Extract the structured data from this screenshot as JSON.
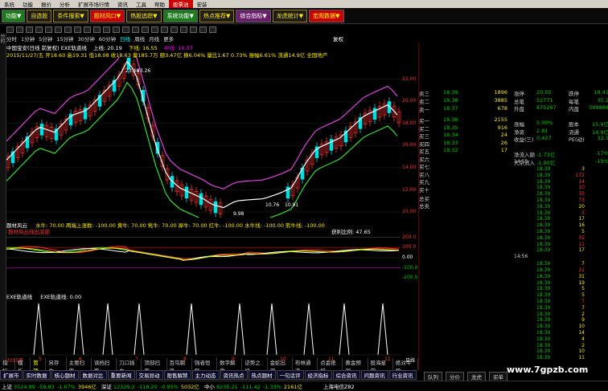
{
  "menu": [
    "系统",
    "功能",
    "报价",
    "分析",
    "扩展市场行情",
    "资讯",
    "工具",
    "帮助",
    "股票池",
    "安装"
  ],
  "menu_hot_index": 8,
  "toolbar_buttons": [
    {
      "label": "功能▼",
      "style": "green"
    },
    {
      "label": "自选股",
      "style": "yellow"
    },
    {
      "label": "条件搜索▼",
      "style": "yellow"
    },
    {
      "label": "题材风口▼",
      "style": "red"
    },
    {
      "label": "热股追踪▼",
      "style": "yellow"
    },
    {
      "label": "系统功能▼",
      "style": "green"
    },
    {
      "label": "热点推荐▼",
      "style": "yellow"
    },
    {
      "label": "综合指标▼",
      "style": "purple"
    },
    {
      "label": "龙虎统计▼",
      "style": "yellow"
    },
    {
      "label": "宏观数据▼",
      "style": "red"
    }
  ],
  "period_tabs": [
    "分时",
    "1分钟",
    "5分钟",
    "15分钟",
    "30分钟",
    "60分钟",
    "日线",
    "周线",
    "月线",
    "更多"
  ],
  "period_selected": 6,
  "side_labels": [
    "分时",
    "技术分析",
    "基本资料"
  ],
  "top_right_label": "复权",
  "main_title_line": "中国宝安(日线 前复权) EXE轨道线",
  "main_title_vals": {
    "up": "上线: 20.19",
    "down": "下线: 16.55",
    "mid": "中线: 18.37"
  },
  "main_info_line": "2015/11/27/五 开18.60 高19.31 低18.08 收18.63 量185.7万 额3.47亿 换6.04% 量比1.67 0.73% 振幅6.61% 流通14.9亿 全国地产",
  "price_labels": {
    "high": "23.46",
    "high2": "23.26",
    "low": "10.76",
    "low2": "10.91",
    "low3": "9.98"
  },
  "y_axis_main": [
    "22.00",
    "20.00",
    "18.00",
    "16.00",
    "14.00",
    "12.00",
    "10.00"
  ],
  "ind1_title": "题材风云",
  "ind1_vals": "水牛: 70.00  两端上涨数: -100.00  黄牛: 70.00  牦牛: 70.00  犀牛: 70.00  红牛: -100.00  水牛线: -100.00  熊牛线: -100.00",
  "ind1_flags": [
    "题材风云线出底部",
    "获利比例: 47.65"
  ],
  "y_axis_ind1": [
    "200.0",
    "100.0",
    "0.00",
    "-100.0",
    "-200.0"
  ],
  "ind2_title": "EXE轨道线",
  "ind2_vals": "EXE轨道线: 0.00",
  "x_axis_labels": [
    "2015年",
    "5",
    "6",
    "7",
    "8",
    "9",
    "10",
    "11",
    "12"
  ],
  "x_axis_year": "日线",
  "chart_data": [
    {
      "type": "line",
      "x": [
        "2015-05",
        "2015-06",
        "2015-07",
        "2015-08",
        "2015-09",
        "2015-10",
        "2015-11",
        "2015-12"
      ],
      "series": [],
      "ylim": [
        10,
        23.5
      ]
    }
  ],
  "right_panel": {
    "sell_levels": [
      {
        "label": "卖三",
        "price": "18.39",
        "vol": "1896"
      },
      {
        "label": "卖二",
        "price": "18.38",
        "vol": "3885"
      },
      {
        "label": "卖一",
        "price": "18.37",
        "vol": "678"
      }
    ],
    "buy_levels": [
      {
        "label": "买一",
        "price": "18.36",
        "vol": "2155"
      },
      {
        "label": "买二",
        "price": "18.35",
        "vol": "916"
      },
      {
        "label": "买三",
        "price": "18.34",
        "vol": "24"
      },
      {
        "label": "买四",
        "price": "18.33",
        "vol": "26"
      },
      {
        "label": "买五",
        "price": "18.32",
        "vol": "17"
      },
      {
        "label": "买六",
        "price": "",
        "vol": ""
      },
      {
        "label": "买七",
        "price": "",
        "vol": ""
      },
      {
        "label": "买八",
        "price": "",
        "vol": ""
      },
      {
        "label": "买九",
        "price": "",
        "vol": ""
      },
      {
        "label": "买十",
        "price": "",
        "vol": ""
      }
    ],
    "total_buy": {
      "label": "总买",
      "value": ""
    },
    "total_sell": {
      "label": "总卖",
      "value": ""
    },
    "quote": [
      {
        "k": "涨停",
        "v1": "20.55",
        "k2": "跌停",
        "v3": "18.41"
      },
      {
        "k": "总笔",
        "v1": "52771",
        "k2": "每笔",
        "v3": "35.2"
      },
      {
        "k": "外盘",
        "v1": "875297",
        "k2": "内盘",
        "v3": "369888"
      },
      {
        "k": "",
        "v1": "",
        "k2": "",
        "v3": ""
      },
      {
        "k": "涨幅",
        "v1": "5.00%",
        "k2": "股本",
        "v3": "15.9亿"
      },
      {
        "k": "净资",
        "v1": "2.81",
        "k2": "流通",
        "v3": "14.9亿"
      },
      {
        "k": "收益(三)",
        "v1": "0.427",
        "k2": "PE(动)",
        "v3": "32.3"
      },
      {
        "k": "",
        "v1": "",
        "k2": "",
        "v3": ""
      },
      {
        "k": "净流入额",
        "v1": "-1.73亿",
        "k2": "",
        "v3": "-17%"
      },
      {
        "k": "大宗流入",
        "v1": "-1.90亿",
        "k2": "",
        "v3": "-19%"
      }
    ],
    "ticks_time1": "14:55",
    "ticks1": [
      {
        "t": "",
        "p": "18.39",
        "q": "3",
        "red": false
      },
      {
        "t": "",
        "p": "18.39",
        "q": "172",
        "red": true
      },
      {
        "t": "",
        "p": "18.39",
        "q": "14",
        "red": true
      },
      {
        "t": "",
        "p": "18.39",
        "q": "10",
        "red": true
      },
      {
        "t": "",
        "p": "18.39",
        "q": "35",
        "red": true
      },
      {
        "t": "",
        "p": "18.39",
        "q": "73",
        "red": true
      },
      {
        "t": "",
        "p": "18.39",
        "q": "20",
        "red": false
      },
      {
        "t": "",
        "p": "18.39",
        "q": "5",
        "red": true
      },
      {
        "t": "",
        "p": "18.39",
        "q": "17",
        "red": false
      },
      {
        "t": "",
        "p": "18.39",
        "q": "16",
        "red": false
      },
      {
        "t": "",
        "p": "18.39",
        "q": "5",
        "red": false
      },
      {
        "t": "",
        "p": "18.39",
        "q": "31",
        "red": true
      },
      {
        "t": "",
        "p": "18.39",
        "q": "11",
        "red": true
      },
      {
        "t": "",
        "p": "18.39",
        "q": "17",
        "red": false
      }
    ],
    "ticks_time2": "14:56",
    "ticks2": [
      {
        "t": "",
        "p": "18.39",
        "q": "7",
        "red": false
      },
      {
        "t": "",
        "p": "18.39",
        "q": "21",
        "red": true
      },
      {
        "t": "",
        "p": "18.39",
        "q": "31",
        "red": false
      },
      {
        "t": "",
        "p": "18.39",
        "q": "19",
        "red": false
      },
      {
        "t": "",
        "p": "18.39",
        "q": "5",
        "red": false
      },
      {
        "t": "",
        "p": "18.39",
        "q": "5",
        "red": false
      },
      {
        "t": "",
        "p": "18.39",
        "q": "7",
        "red": true
      },
      {
        "t": "",
        "p": "18.39",
        "q": "7",
        "red": false
      },
      {
        "t": "",
        "p": "18.39",
        "q": "2",
        "red": false
      },
      {
        "t": "",
        "p": "18.39",
        "q": "9",
        "red": false
      },
      {
        "t": "",
        "p": "18.39",
        "q": "10",
        "red": false
      },
      {
        "t": "",
        "p": "18.39",
        "q": "14",
        "red": false
      },
      {
        "t": "",
        "p": "18.39",
        "q": "4",
        "red": false
      },
      {
        "t": "",
        "p": "18.39",
        "q": "2",
        "red": false
      },
      {
        "t": "",
        "p": "18.39",
        "q": "10",
        "red": false
      },
      {
        "t": "",
        "p": "18.39",
        "q": "11",
        "red": false
      },
      {
        "t": "",
        "p": "18.39",
        "q": "4",
        "red": false
      },
      {
        "t": "",
        "p": "18.39",
        "q": "2",
        "red": false
      },
      {
        "t": "",
        "p": "18.38",
        "q": "6",
        "red": false
      },
      {
        "t": "",
        "p": "18.39",
        "q": "4",
        "red": false
      },
      {
        "t": "",
        "p": "18.39",
        "q": "4",
        "red": false
      }
    ]
  },
  "tabs": [
    "指标",
    "模板",
    "管理",
    "另存为",
    "主要扫库",
    "读档扫库",
    "刀口插血",
    "顶部扫库",
    "百鸟朝凤",
    "强者恒强",
    "数字解盘",
    "逆势之星",
    "金蛇出洞",
    "布林通道",
    "点金绝招",
    "黄金预测",
    "股海星空",
    "绝对牛股"
  ],
  "tabs_active": 2,
  "bottom_menu": [
    "扩展市",
    "实时数据",
    "核心题材",
    "数据对比",
    "重要新闻",
    "交易异动",
    "限售解禁",
    "主力动态",
    "资讯热点",
    "热点题材",
    "一句话评",
    "经济指标",
    "综合资讯",
    "问题资讯",
    "行业资讯"
  ],
  "right_tabs": [
    "队列",
    "分价",
    "龙虎",
    "买单"
  ],
  "status": [
    {
      "label": "上证",
      "val": "3524.99",
      "chg": "-59.83",
      "pct": "-1.67%",
      "amt": "3946亿"
    },
    {
      "label": "深证",
      "val": "12329.2",
      "chg": "-118.20",
      "pct": "-0.95%",
      "amt": "5032亿"
    },
    {
      "label": "中小",
      "val": "8235.21",
      "chg": "-111.42",
      "pct": "-1.33%",
      "amt": "2161亿"
    }
  ],
  "status_right": "上海电信Z82",
  "watermark": "www.7gpzb.com"
}
